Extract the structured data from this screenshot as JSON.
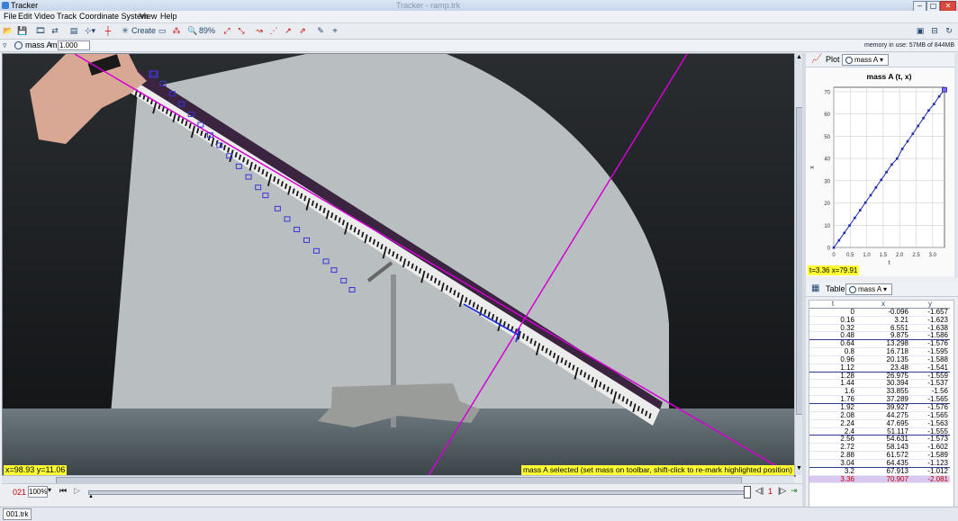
{
  "window": {
    "title": "Tracker",
    "dim_title": "Tracker - ramp.trk",
    "controls": [
      "–",
      "▢",
      "✕"
    ]
  },
  "menu": [
    "File",
    "Edit",
    "Video",
    "Track",
    "Coordinate System",
    "View",
    "Help"
  ],
  "toolbar": {
    "create_label": "Create",
    "zoom_label": "89%",
    "memory_label": "memory in use: 57MB of 844MB"
  },
  "trackbar": {
    "track_name": "mass A",
    "mass_label": "m",
    "mass_value": "1.000"
  },
  "video": {
    "coords_readout": "x=98.93  y=11.06",
    "status_message": "mass A selected (set mass on toolbar, shift-click to re-mark highlighted position)"
  },
  "player": {
    "frame": "021",
    "rate": "100%",
    "step": "1"
  },
  "status": {
    "file_tab": "001.trk"
  },
  "plot": {
    "button": "Plot",
    "track": "mass A",
    "readout": "t=3.36  x=79.91"
  },
  "table": {
    "button": "Table",
    "track": "mass A",
    "headers": [
      "t",
      "x",
      "y"
    ],
    "rows": [
      [
        "0",
        "-0.096",
        "-1.657"
      ],
      [
        "0.16",
        "3.21",
        "-1.623"
      ],
      [
        "0.32",
        "6.551",
        "-1.638"
      ],
      [
        "0.48",
        "9.875",
        "-1.586"
      ],
      [
        "0.64",
        "13.298",
        "-1.576"
      ],
      [
        "0.8",
        "16.718",
        "-1.595"
      ],
      [
        "0.96",
        "20.135",
        "-1.588"
      ],
      [
        "1.12",
        "23.48",
        "-1.541"
      ],
      [
        "1.28",
        "26.975",
        "-1.559"
      ],
      [
        "1.44",
        "30.394",
        "-1.537"
      ],
      [
        "1.6",
        "33.855",
        "-1.56"
      ],
      [
        "1.76",
        "37.289",
        "-1.565"
      ],
      [
        "1.92",
        "39.927",
        "-1.576"
      ],
      [
        "2.08",
        "44.275",
        "-1.565"
      ],
      [
        "2.24",
        "47.695",
        "-1.563"
      ],
      [
        "2.4",
        "51.117",
        "-1.555"
      ],
      [
        "2.56",
        "54.631",
        "-1.573"
      ],
      [
        "2.72",
        "58.143",
        "-1.602"
      ],
      [
        "2.88",
        "61.572",
        "-1.589"
      ],
      [
        "3.04",
        "64.435",
        "-1.123"
      ],
      [
        "3.2",
        "67.913",
        "-1.012"
      ],
      [
        "3.36",
        "70.907",
        "-2.081"
      ]
    ]
  },
  "colors": {
    "accent": "#6b2bd6",
    "readout_bg": "#ffff33",
    "plot_line": "#1a2ca8",
    "axis_line": "#d400d4"
  },
  "chart_data": {
    "type": "line",
    "title": "mass A (t, x)",
    "xlabel": "t",
    "ylabel": "x",
    "xlim": [
      0,
      3.36
    ],
    "ylim": [
      0,
      72
    ],
    "xticks": [
      "0",
      "0.5",
      "1.0",
      "1.5",
      "2.0",
      "2.5",
      "3.0"
    ],
    "yticks": [
      "0",
      "10",
      "20",
      "30",
      "40",
      "50",
      "60",
      "70"
    ],
    "grid": true,
    "series": [
      {
        "x": [
          0,
          0.16,
          0.32,
          0.48,
          0.64,
          0.8,
          0.96,
          1.12,
          1.28,
          1.44,
          1.6,
          1.76,
          1.92,
          2.08,
          2.24,
          2.4,
          2.56,
          2.72,
          2.88,
          3.04,
          3.2,
          3.36
        ],
        "y": [
          -0.096,
          3.21,
          6.551,
          9.875,
          13.298,
          16.718,
          20.135,
          23.48,
          26.975,
          30.394,
          33.855,
          37.289,
          39.927,
          44.275,
          47.695,
          51.117,
          54.631,
          58.143,
          61.572,
          64.435,
          67.913,
          70.907
        ]
      }
    ]
  }
}
